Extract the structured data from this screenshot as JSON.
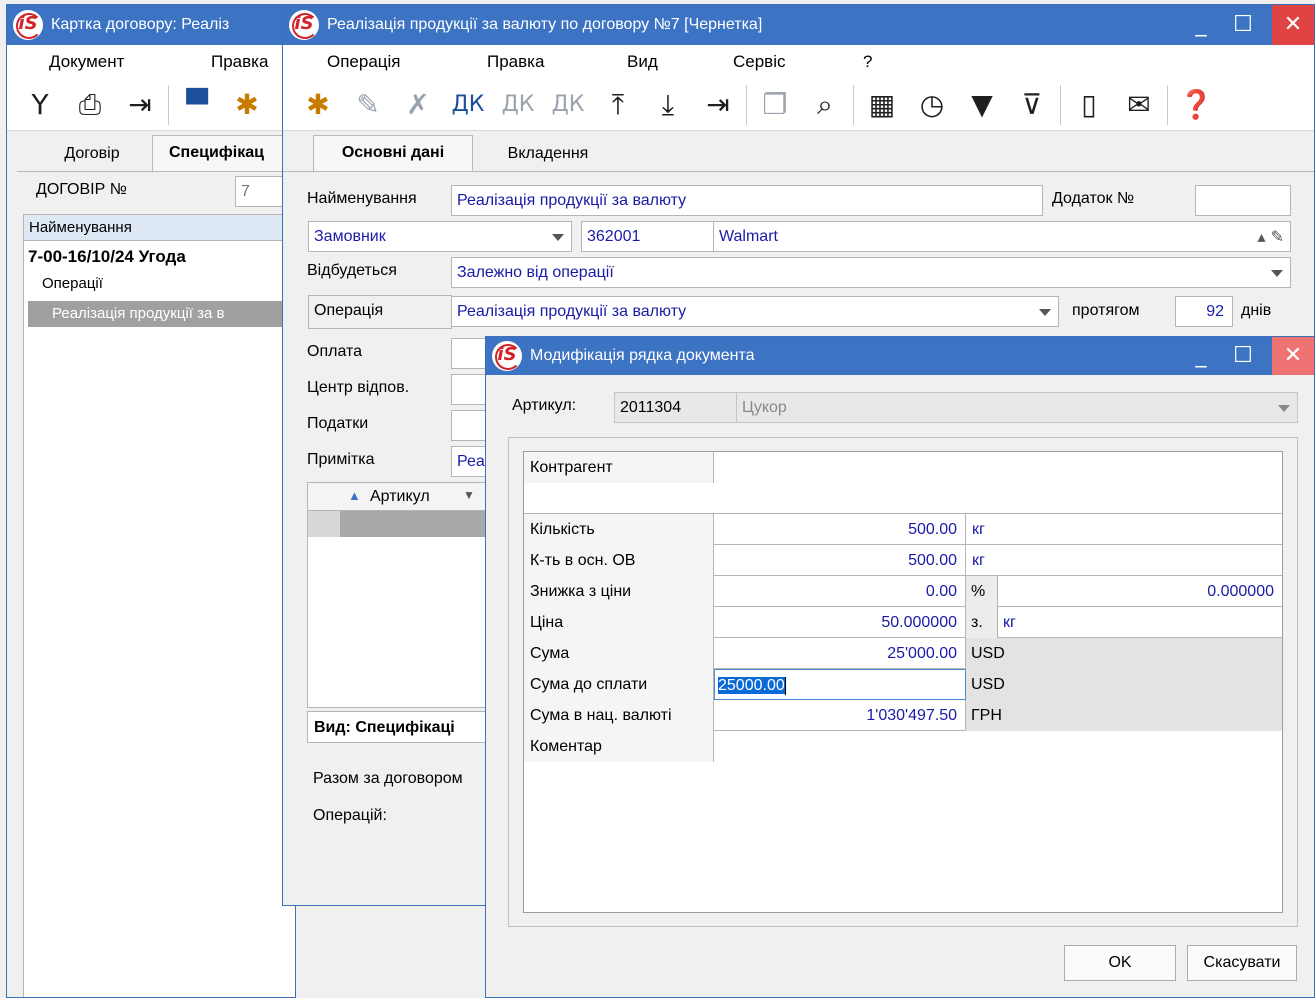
{
  "win1": {
    "title": "Картка договору:  Реаліз",
    "menu": [
      "Документ",
      "Правка"
    ],
    "tabs": [
      "Договір",
      "Специфікац"
    ],
    "contract_label": "ДОГОВІР №",
    "contract_no": "7",
    "tree_header": "Найменування",
    "tree_root": "7-00-16/10/24 Угода",
    "tree_ops": "Операції",
    "tree_selected": "Реалізація продукції за в"
  },
  "win2": {
    "title": "Реалізація продукції за валюту по договору №7 [Чернетка]",
    "menu": [
      "Операція",
      "Правка",
      "Вид",
      "Сервіс",
      "?"
    ],
    "tabs": [
      "Основні дані",
      "Вкладення"
    ],
    "name_label": "Найменування",
    "name_value": "Реалізація продукції за валюту",
    "addendum_label": "Додаток №",
    "addendum_value": "",
    "customer_select": "Замовник",
    "customer_code": "362001",
    "customer_name": "Walmart",
    "occurs_label": "Відбудеться",
    "occurs_value": "Залежно від операції",
    "operation_label": "Операція",
    "operation_value": "Реалізація продукції за валюту",
    "within_label": "протягом",
    "within_value": "92",
    "days_label": "днів",
    "payment_label": "Оплата",
    "center_label": "Центр відпов.",
    "taxes_label": "Податки",
    "note_label": "Примітка",
    "note_value": "Реа",
    "article_col": "Артикул",
    "view_label": "Вид: Специфікаці",
    "total_label": "Разом за договором",
    "ops_label": "Операцій:"
  },
  "dialog": {
    "title": "Модифікація рядка документа",
    "article_label": "Артикул:",
    "article_code": "2011304",
    "article_name": "Цукор",
    "rows": [
      {
        "label": "Контрагент",
        "value": "",
        "unit": "",
        "extra": ""
      },
      {
        "label": "Кількість",
        "value": "500.00",
        "unit": "кг",
        "extra": ""
      },
      {
        "label": "К-ть в осн. ОВ",
        "value": "500.00",
        "unit": "кг",
        "extra": ""
      },
      {
        "label": "Знижка з ціни",
        "value": "0.00",
        "unit": "%",
        "extra": "0.000000"
      },
      {
        "label": "Ціна",
        "value": "50.000000",
        "unit": "з.",
        "extra": "кг"
      },
      {
        "label": "Сума",
        "value": "25'000.00",
        "unit": "USD",
        "extra": ""
      },
      {
        "label": "Сума до сплати",
        "value": "25000.00",
        "unit": "USD",
        "extra": ""
      },
      {
        "label": "Сума в нац. валюті",
        "value": "1'030'497.50",
        "unit": "ГРН",
        "extra": ""
      },
      {
        "label": "Коментар",
        "value": "",
        "unit": "",
        "extra": ""
      }
    ],
    "ok_label": "OK",
    "cancel_label": "Скасувати"
  }
}
